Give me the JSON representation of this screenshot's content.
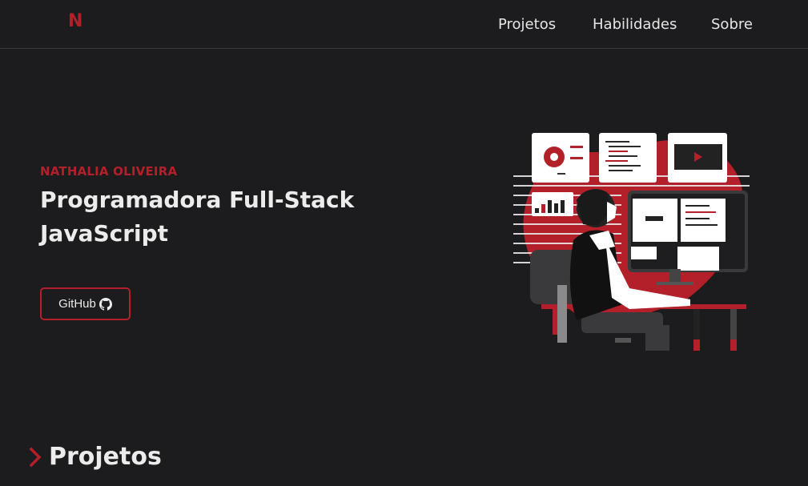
{
  "header": {
    "logo": "N",
    "nav": [
      {
        "label": "Projetos"
      },
      {
        "label": "Habilidades"
      },
      {
        "label": "Sobre"
      }
    ]
  },
  "hero": {
    "name": "NATHALIA OLIVEIRA",
    "title": "Programadora Full-Stack JavaScript",
    "github_label": "GitHub",
    "github_icon": "github-icon"
  },
  "section": {
    "heading": "Projetos",
    "icon": "chevron-right-icon"
  },
  "colors": {
    "background": "#1c1b1d",
    "accent": "#b3202a",
    "text": "#ececec"
  }
}
